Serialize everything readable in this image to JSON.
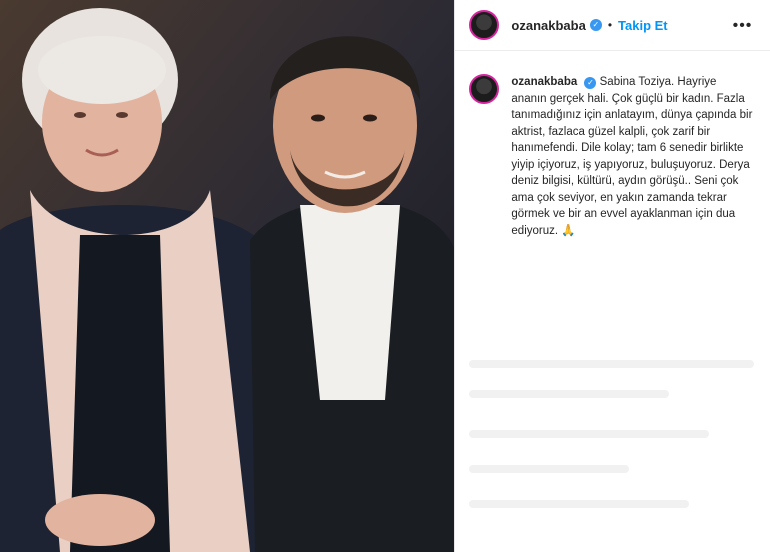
{
  "header": {
    "username": "ozanakbaba",
    "verified_icon": "verified-badge-icon",
    "separator": "•",
    "follow_label": "Takip Et",
    "more_icon": "more-options-icon",
    "more_label": "•••"
  },
  "caption": {
    "username": "ozanakbaba",
    "text": "Sabina Toziya. Hayriye ananın gerçek hali. Çok güçlü bir kadın. Fazla tanımadığınız için anlatayım, dünya çapında bir aktrist, fazlaca güzel kalpli, çok zarif bir hanımefendi. Dile kolay; tam 6 senedir birlikte yiyip içiyoruz, iş yapıyoruz, buluşuyoruz. Derya deniz bilgisi, kültürü, aydın görüşü.. Seni çok ama çok seviyor, en yakın zamanda tekrar görmek ve bir an evvel ayaklanman için dua ediyoruz. 🙏"
  },
  "photo": {
    "subject": "post-photo"
  },
  "colors": {
    "link": "#0095f6",
    "verified": "#3897f0",
    "text": "#262626"
  }
}
